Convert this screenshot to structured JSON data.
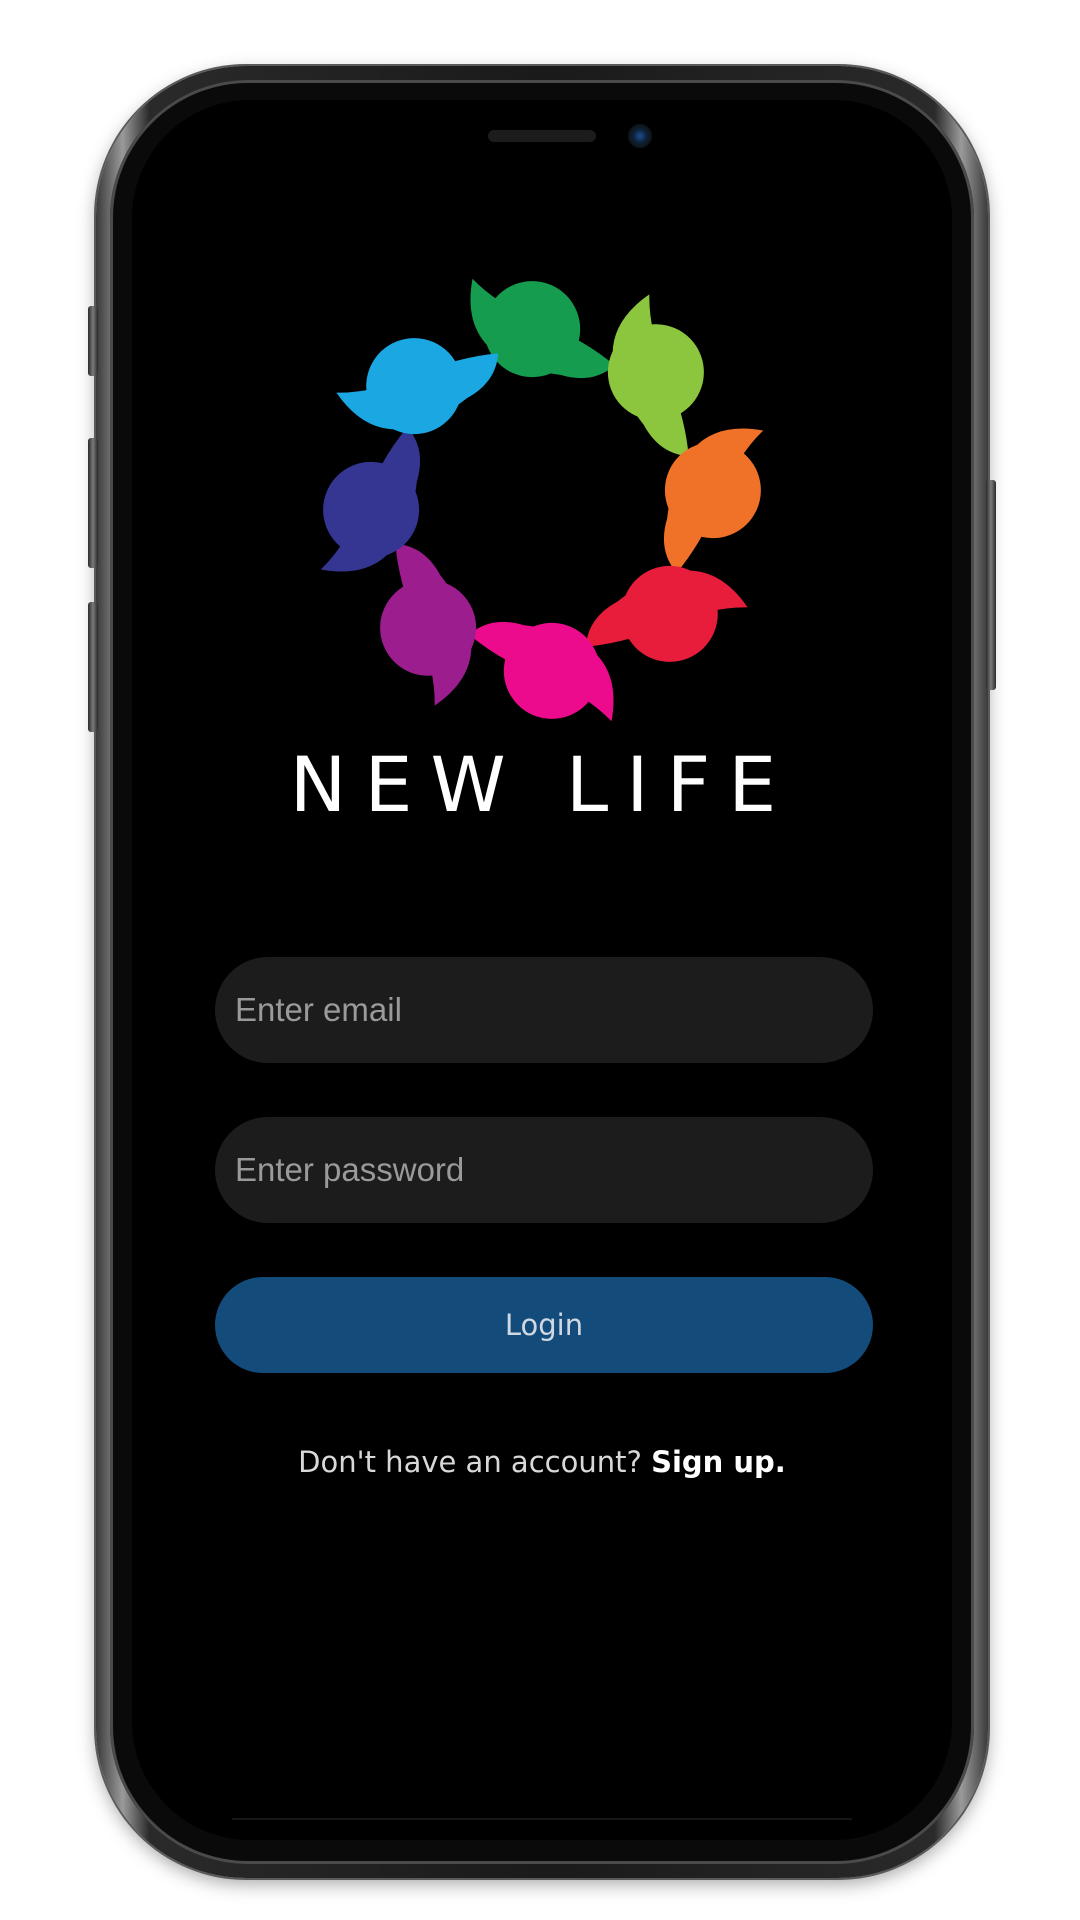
{
  "app": {
    "brand_name": "NEW LIFE"
  },
  "login_form": {
    "email_placeholder": "Enter email",
    "password_placeholder": "Enter password",
    "login_label": "Login"
  },
  "signup": {
    "prompt": "Don't have an account?",
    "link_label": "Sign up."
  },
  "colors": {
    "screen_background": "#000000",
    "input_background": "#1c1c1c",
    "login_button": "#134c7b",
    "logo_petals": [
      "#169c4f",
      "#8cc63f",
      "#f07128",
      "#e81d3b",
      "#ec0b8d",
      "#9b1d8e",
      "#353592",
      "#1aa7e2"
    ]
  },
  "icons": {
    "logo": "new-life-circle-of-people-logo"
  }
}
